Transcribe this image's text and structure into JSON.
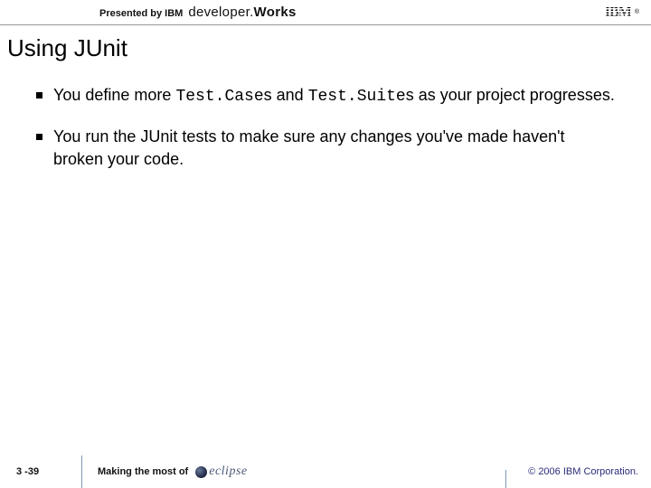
{
  "header": {
    "presented_by": "Presented by IBM",
    "brand_light": "developer.",
    "brand_bold": "Works",
    "ibm": "IBM",
    "reg": "®"
  },
  "title": "Using JUnit",
  "bullets": [
    {
      "pre": "You define more ",
      "code1": "Test.Case",
      "mid1": "s and ",
      "code2": "Test.Suite",
      "mid2": "s as your project progresses."
    },
    {
      "text": "You run the JUnit tests to make sure any changes you've made haven't broken your code."
    }
  ],
  "footer": {
    "slide_number": "3 -39",
    "making": "Making the most of",
    "eclipse": "eclipse",
    "copyright": "© 2006 IBM Corporation."
  }
}
